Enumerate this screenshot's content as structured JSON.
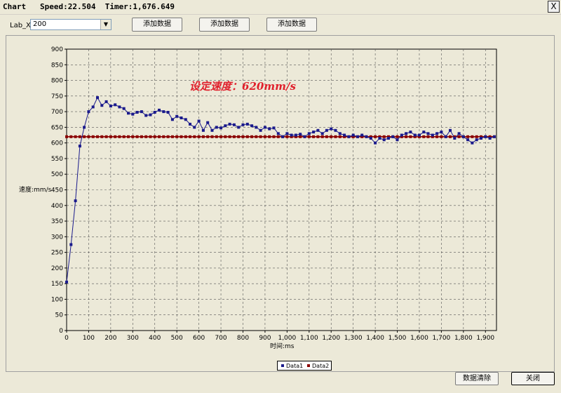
{
  "window": {
    "title": "Chart   Speed:22.504  Timer:1,676.649",
    "close": "X"
  },
  "toolbar": {
    "lab_label": "Lab_X",
    "lab_value": "200",
    "add1": "添加数据",
    "add2": "添加数据",
    "add3": "添加数据",
    "clear": "数据清除",
    "close": "关闭"
  },
  "chart_data": {
    "type": "line",
    "annotation": "设定速度：620mm/s",
    "xlabel": "时间:ms",
    "ylabel": "速度:mm/s",
    "xlim": [
      0,
      1950
    ],
    "ylim": [
      0,
      900
    ],
    "xticks": [
      0,
      100,
      200,
      300,
      400,
      500,
      600,
      700,
      800,
      900,
      1000,
      1100,
      1200,
      1300,
      1400,
      1500,
      1600,
      1700,
      1800,
      1900
    ],
    "xtick_labels": [
      "0",
      "100",
      "200",
      "300",
      "400",
      "500",
      "600",
      "700",
      "800",
      "900",
      "1,000",
      "1,100",
      "1,200",
      "1,300",
      "1,400",
      "1,500",
      "1,600",
      "1,700",
      "1,800",
      "1,900"
    ],
    "yticks": [
      0,
      50,
      100,
      150,
      200,
      250,
      300,
      350,
      400,
      450,
      500,
      550,
      600,
      650,
      700,
      750,
      800,
      850,
      900
    ],
    "grid": true,
    "legend_position": "bottom-center",
    "series": [
      {
        "name": "Data1",
        "color": "#1a1a8c",
        "x": [
          0,
          20,
          40,
          60,
          80,
          100,
          120,
          140,
          160,
          180,
          200,
          220,
          240,
          260,
          280,
          300,
          320,
          340,
          360,
          380,
          400,
          420,
          440,
          460,
          480,
          500,
          520,
          540,
          560,
          580,
          600,
          620,
          640,
          660,
          680,
          700,
          720,
          740,
          760,
          780,
          800,
          820,
          840,
          860,
          880,
          900,
          920,
          940,
          960,
          980,
          1000,
          1020,
          1040,
          1060,
          1080,
          1100,
          1120,
          1140,
          1160,
          1180,
          1200,
          1220,
          1240,
          1260,
          1280,
          1300,
          1320,
          1340,
          1360,
          1380,
          1400,
          1420,
          1440,
          1460,
          1480,
          1500,
          1520,
          1540,
          1560,
          1580,
          1600,
          1620,
          1640,
          1660,
          1680,
          1700,
          1720,
          1740,
          1760,
          1780,
          1800,
          1820,
          1840,
          1860,
          1880,
          1900,
          1920,
          1940
        ],
        "y": [
          155,
          275,
          415,
          590,
          650,
          700,
          715,
          745,
          720,
          732,
          718,
          722,
          715,
          710,
          695,
          692,
          698,
          700,
          688,
          690,
          698,
          705,
          700,
          698,
          675,
          685,
          680,
          675,
          660,
          650,
          670,
          640,
          665,
          640,
          650,
          648,
          655,
          660,
          658,
          650,
          658,
          660,
          655,
          650,
          640,
          650,
          645,
          648,
          630,
          620,
          630,
          625,
          625,
          628,
          620,
          630,
          635,
          640,
          630,
          640,
          645,
          640,
          630,
          625,
          620,
          625,
          620,
          625,
          620,
          615,
          600,
          615,
          610,
          615,
          620,
          610,
          625,
          630,
          635,
          625,
          625,
          635,
          630,
          625,
          630,
          635,
          620,
          640,
          615,
          630,
          620,
          610,
          600,
          610,
          615,
          620,
          615,
          620
        ]
      },
      {
        "name": "Data2",
        "color": "#8b0000",
        "x": [
          0,
          20,
          40,
          60,
          80,
          100,
          120,
          140,
          160,
          180,
          200,
          220,
          240,
          260,
          280,
          300,
          320,
          340,
          360,
          380,
          400,
          420,
          440,
          460,
          480,
          500,
          520,
          540,
          560,
          580,
          600,
          620,
          640,
          660,
          680,
          700,
          720,
          740,
          760,
          780,
          800,
          820,
          840,
          860,
          880,
          900,
          920,
          940,
          960,
          980,
          1000,
          1020,
          1040,
          1060,
          1080,
          1100,
          1120,
          1140,
          1160,
          1180,
          1200,
          1220,
          1240,
          1260,
          1280,
          1300,
          1320,
          1340,
          1360,
          1380,
          1400,
          1420,
          1440,
          1460,
          1480,
          1500,
          1520,
          1540,
          1560,
          1580,
          1600,
          1620,
          1640,
          1660,
          1680,
          1700,
          1720,
          1740,
          1760,
          1780,
          1800,
          1820,
          1840,
          1860,
          1880,
          1900,
          1920,
          1940
        ],
        "y": [
          620,
          620,
          620,
          620,
          620,
          620,
          620,
          620,
          620,
          620,
          620,
          620,
          620,
          620,
          620,
          620,
          620,
          620,
          620,
          620,
          620,
          620,
          620,
          620,
          620,
          620,
          620,
          620,
          620,
          620,
          620,
          620,
          620,
          620,
          620,
          620,
          620,
          620,
          620,
          620,
          620,
          620,
          620,
          620,
          620,
          620,
          620,
          620,
          620,
          620,
          620,
          620,
          620,
          620,
          620,
          620,
          620,
          620,
          620,
          620,
          620,
          620,
          620,
          620,
          620,
          620,
          620,
          620,
          620,
          620,
          620,
          620,
          620,
          620,
          620,
          620,
          620,
          620,
          620,
          620,
          620,
          620,
          620,
          620,
          620,
          620,
          620,
          620,
          620,
          620,
          620,
          620,
          620,
          620,
          620,
          620,
          620,
          620
        ]
      }
    ]
  }
}
